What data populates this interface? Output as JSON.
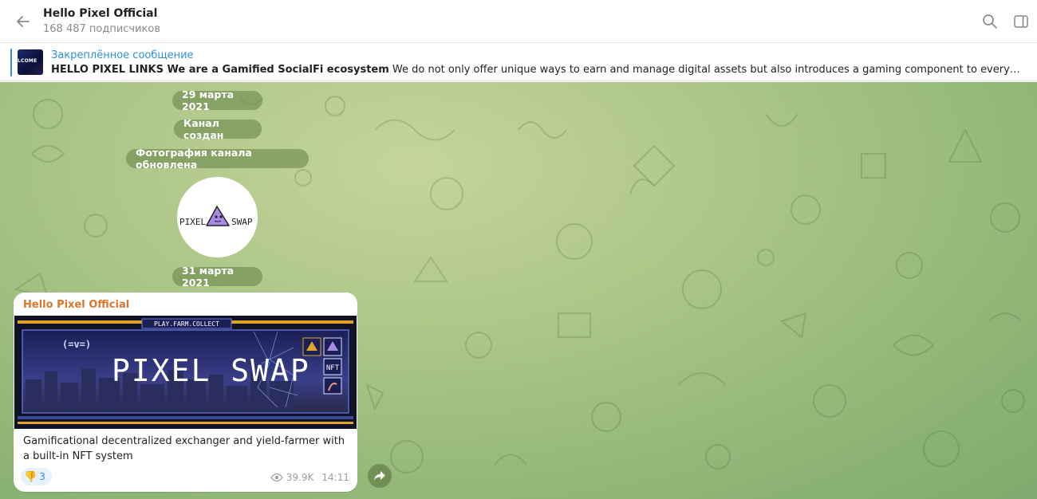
{
  "header": {
    "title": "Hello Pixel Official",
    "subtitle": "168 487 подписчиков",
    "back_icon": "arrow-left-icon",
    "search_icon": "search-icon",
    "sidebar_icon": "sidebar-toggle-icon"
  },
  "pinned": {
    "label": "Закреплённое сообщение",
    "thumb_text": "LCOME",
    "text_bold": "HELLO PIXEL LINKS  We are a Gamified SocialFi ecosystem",
    "text_rest": " We do not only offer unique ways to earn and manage digital assets but also introduces a gaming component to every interaction, making fina…"
  },
  "service": {
    "date1": "29 марта 2021",
    "created": "Канал создан",
    "photo_updated": "Фотография канала обновлена",
    "date2": "31 марта 2021"
  },
  "avatar": {
    "left_text": "PIXEL",
    "right_text": "SWAP"
  },
  "message": {
    "author": "Hello Pixel Official",
    "image_top_label": "PLAY.FARM.COLLECT",
    "image_title": "PIXEL SWAP",
    "image_nft": "NFT",
    "text": "Gamificational decentralized exchanger and yield-farmer with a built-in NFT system",
    "reaction_emoji": "👎",
    "reaction_count": "3",
    "views": "39.9K",
    "time": "14:11",
    "views_icon": "eye-icon",
    "share_icon": "share-arrow-icon"
  },
  "colors": {
    "accent": "#2e8fd8",
    "author": "#d9772e",
    "chat_bg": "#a9c585"
  }
}
